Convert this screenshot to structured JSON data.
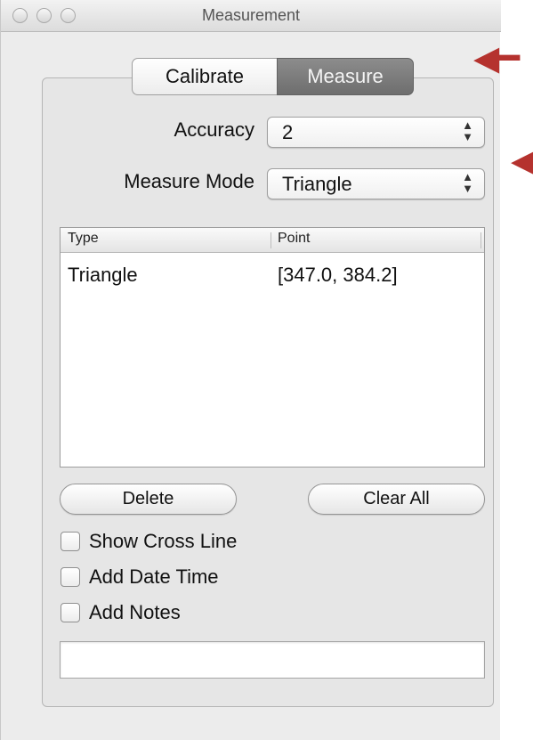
{
  "window": {
    "title": "Measurement"
  },
  "tabs": [
    {
      "label": "Calibrate",
      "selected": false
    },
    {
      "label": "Measure",
      "selected": true
    }
  ],
  "accuracy": {
    "label": "Accuracy",
    "value": "2"
  },
  "measure_mode": {
    "label": "Measure Mode",
    "value": "Triangle"
  },
  "table": {
    "columns": [
      "Type",
      "Point"
    ],
    "rows": [
      {
        "type": "Triangle",
        "point": "[347.0, 384.2]"
      }
    ]
  },
  "buttons": {
    "delete": "Delete",
    "clear_all": "Clear All"
  },
  "checkboxes": [
    {
      "label": "Show Cross Line",
      "checked": false
    },
    {
      "label": "Add Date Time",
      "checked": false
    },
    {
      "label": "Add Notes",
      "checked": false
    }
  ],
  "notes_input": {
    "value": ""
  },
  "icons": {
    "stepper": "up-down-chevron-icon",
    "annotation": "left-arrow-icon"
  },
  "colors": {
    "annotation_arrow": "#b5322e",
    "selected_tab": "#7a7a7a",
    "window_bg": "#ececec"
  }
}
